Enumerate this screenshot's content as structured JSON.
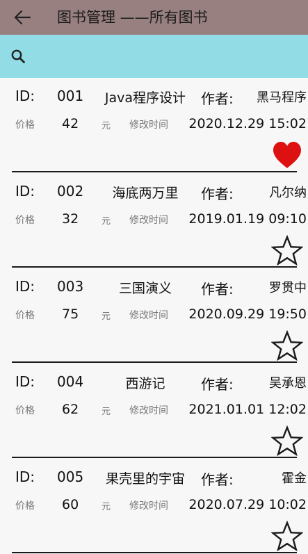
{
  "header": {
    "title": "图书管理 ——所有图书",
    "back_icon": "arrow-left-icon",
    "background": "#998080"
  },
  "search": {
    "icon": "search-icon",
    "background": "#92dce6"
  },
  "labels": {
    "id": "ID:",
    "author": "作者:",
    "price": "价格",
    "yuan": "元",
    "modified": "修改时间"
  },
  "books": [
    {
      "id": "001",
      "name": "Java程序设计",
      "author": "黑马程序",
      "price": "42",
      "time": "2020.12.29 15:02",
      "favorite": true
    },
    {
      "id": "002",
      "name": "海底两万里",
      "author": "凡尔纳",
      "price": "32",
      "time": "2019.01.19 09:10",
      "favorite": false
    },
    {
      "id": "003",
      "name": "三国演义",
      "author": "罗贯中",
      "price": "75",
      "time": "2020.09.29 19:50",
      "favorite": false
    },
    {
      "id": "004",
      "name": "西游记",
      "author": "吴承恩",
      "price": "62",
      "time": "2021.01.01 12:02",
      "favorite": false
    },
    {
      "id": "005",
      "name": "果壳里的宇宙",
      "author": "霍金",
      "price": "60",
      "time": "2020.07.29 10:02",
      "favorite": false
    }
  ],
  "colors": {
    "favorite": "#dd1111",
    "divider": "#1a1a1a"
  }
}
